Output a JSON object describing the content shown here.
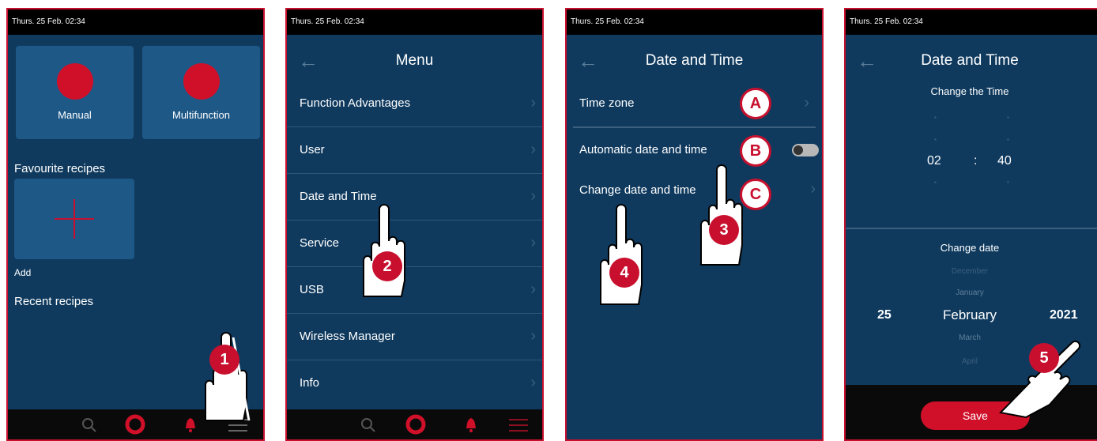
{
  "status_time": "Thurs. 25 Feb. 02:34",
  "screen1": {
    "tiles": [
      {
        "label": "Manual"
      },
      {
        "label": "Multifunction"
      }
    ],
    "favourites_heading": "Favourite recipes",
    "add_label": "Add",
    "recent_heading": "Recent recipes",
    "step": "1"
  },
  "screen2": {
    "title": "Menu",
    "items": [
      {
        "label": "Function Advantages"
      },
      {
        "label": "User"
      },
      {
        "label": "Date and Time"
      },
      {
        "label": "Service"
      },
      {
        "label": "USB"
      },
      {
        "label": "Wireless Manager"
      },
      {
        "label": "Info"
      }
    ],
    "step": "2"
  },
  "screen3": {
    "title": "Date and Time",
    "items": [
      {
        "label": "Time zone",
        "marker": "A"
      },
      {
        "label": "Automatic date and time",
        "marker": "B"
      },
      {
        "label": "Change date and time",
        "marker": "C"
      }
    ],
    "steps": [
      "3",
      "4"
    ]
  },
  "screen4": {
    "title": "Date and Time",
    "time_heading": "Change the Time",
    "hour": "02",
    "minute": "40",
    "time_separator": ":",
    "date_heading": "Change date",
    "months_above": [
      "December",
      "January"
    ],
    "month": "February",
    "months_below": [
      "March",
      "April"
    ],
    "day": "25",
    "year": "2021",
    "save_label": "Save",
    "step": "5"
  },
  "colors": {
    "accent": "#c8102e",
    "panel": "#0f3a5e",
    "tile": "#1e5887"
  }
}
